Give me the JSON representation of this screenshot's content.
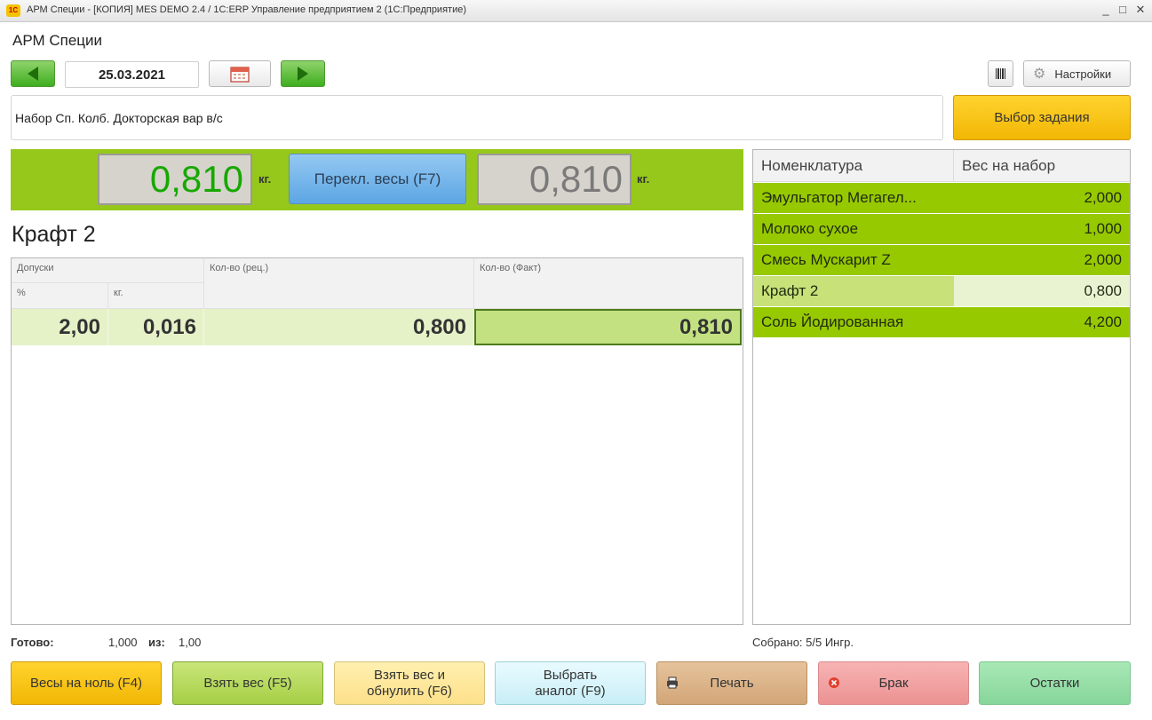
{
  "window": {
    "title": "АРМ Специи - [КОПИЯ] MES DEMO 2.4 / 1С:ERP Управление предприятием 2  (1С:Предприятие)",
    "logo_text": "1С",
    "minimize": "_",
    "maximize": "□",
    "close": "✕"
  },
  "app": {
    "title": "АРМ Специи"
  },
  "toolbar": {
    "date": "25.03.2021",
    "settings_label": "Настройки"
  },
  "task": {
    "name": "Набор Сп. Колб. Докторская вар в/с",
    "select_label": "Выбор задания"
  },
  "scales": {
    "scale1_value": "0,810",
    "scale2_value": "0,810",
    "unit": "кг.",
    "switch_label": "Перекл. весы (F7)",
    "scale1_color": "#17a800",
    "scale2_color": "#7a7a7a"
  },
  "current_item": {
    "name": "Крафт 2",
    "headers": {
      "tolerances": "Допуски",
      "percent": "%",
      "kg": "кг.",
      "qty_recipe": "Кол-во (рец.)",
      "qty_fact": "Кол-во (Факт)"
    },
    "row": {
      "percent": "2,00",
      "kg": "0,016",
      "qty_recipe": "0,800",
      "qty_fact": "0,810"
    }
  },
  "ingredients": {
    "headers": {
      "name": "Номенклатура",
      "weight": "Вес на набор"
    },
    "rows": [
      {
        "name": "Эмульгатор Мегагел...",
        "weight": "2,000"
      },
      {
        "name": "Молоко сухое",
        "weight": "1,000"
      },
      {
        "name": "Смесь Мускарит Z",
        "weight": "2,000"
      },
      {
        "name": "Крафт 2",
        "weight": "0,800"
      },
      {
        "name": "Соль Йодированная",
        "weight": "4,200"
      }
    ],
    "current_index": 3
  },
  "status": {
    "ready_label": "Готово:",
    "ready_value": "1,000",
    "of_label": "из:",
    "of_value": "1,00",
    "collected": "Собрано: 5/5 Ингр."
  },
  "buttons": {
    "zero": "Весы на ноль (F4)",
    "take": "Взять вес (F5)",
    "take_zero": "Взять вес и обнулить (F6)",
    "analog": "Выбрать аналог (F9)",
    "print": "Печать",
    "reject": "Брак",
    "remains": "Остатки"
  },
  "colors": {
    "accent_green": "#96c81c",
    "row_done": "#97c900",
    "task_button": "#f2b705",
    "switch_button": "#5da6e4"
  }
}
